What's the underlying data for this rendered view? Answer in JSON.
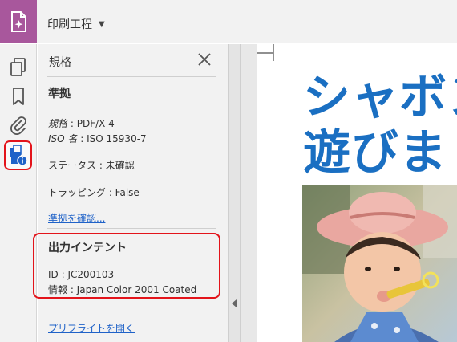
{
  "toolbar": {
    "title": "印刷工程"
  },
  "panel": {
    "title": "規格",
    "compliance": {
      "heading": "準拠",
      "standard_label": "規格",
      "standard_value": ": PDF/X-4",
      "iso_label": "ISO 名",
      "iso_value": ": ISO 15930-7",
      "status": "ステータス : 未確認",
      "trapping": "トラッピング : False",
      "verify_link": "準拠を確認..."
    },
    "output_intent": {
      "heading": "出力インテント",
      "id": "ID : JC200103",
      "info": "情報 : Japan Color 2001 Coated"
    },
    "preflight_link": "プリフライトを開く"
  },
  "document": {
    "headline_line1": "シャボン",
    "headline_line2": "遊びま"
  },
  "colors": {
    "app_accent": "#a8579c",
    "highlight": "#e3141b",
    "link": "#1f62c8",
    "headline": "#1a6fc2"
  },
  "icons": {
    "rail": [
      "pages-icon",
      "bookmark-icon",
      "attachment-icon",
      "standards-icon"
    ]
  }
}
